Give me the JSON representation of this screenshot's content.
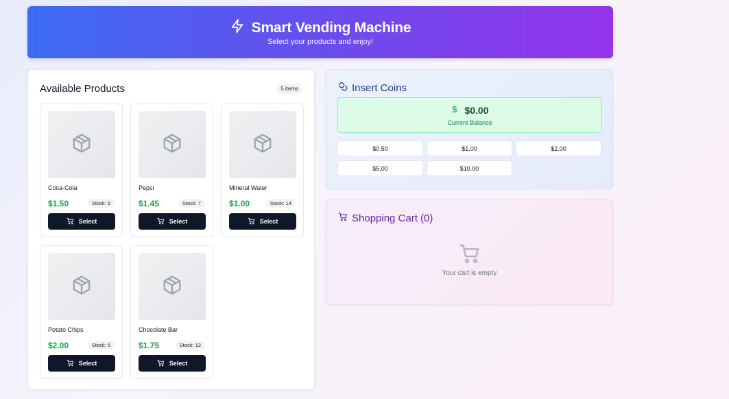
{
  "header": {
    "title": "Smart Vending Machine",
    "subtitle": "Select your products and enjoy!",
    "icon": "lightning-icon"
  },
  "products_panel": {
    "title": "Available Products",
    "count_badge": "5 items",
    "select_label": "Select",
    "products": [
      {
        "name": "Coca-Cola",
        "price": "$1.50",
        "stock": "Stock: 9"
      },
      {
        "name": "Pepsi",
        "price": "$1.45",
        "stock": "Stock: 7"
      },
      {
        "name": "Mineral Water",
        "price": "$1.00",
        "stock": "Stock: 14"
      },
      {
        "name": "Potato Chips",
        "price": "$2.00",
        "stock": "Stock: 5"
      },
      {
        "name": "Chocolate Bar",
        "price": "$1.75",
        "stock": "Stock: 12"
      }
    ]
  },
  "coins_panel": {
    "title": "Insert Coins",
    "balance": "$0.00",
    "balance_label": "Current Balance",
    "coins": [
      "$0.50",
      "$1.00",
      "$2.00",
      "$5.00",
      "$10.00"
    ]
  },
  "cart_panel": {
    "title": "Shopping Cart (0)",
    "empty_text": "Your cart is empty"
  },
  "colors": {
    "header_gradient_start": "#3b6cf1",
    "header_gradient_end": "#9433ea",
    "price_green": "#16a34a",
    "button_dark": "#0f172a",
    "coins_title": "#1e3a8a",
    "cart_title": "#6b21a8"
  }
}
